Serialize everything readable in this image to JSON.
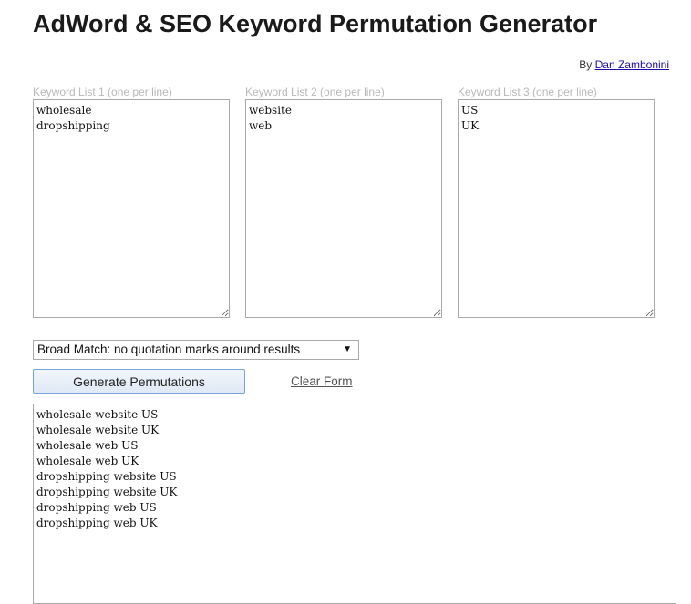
{
  "header": {
    "title": "AdWord & SEO Keyword Permutation Generator",
    "by_prefix": "By",
    "author": "Dan Zambonini"
  },
  "lists": [
    {
      "label": "Keyword List 1 (one per line)",
      "value": "wholesale\ndropshipping"
    },
    {
      "label": "Keyword List 2 (one per line)",
      "value": "website\nweb"
    },
    {
      "label": "Keyword List 3 (one per line)",
      "value": "US\nUK"
    }
  ],
  "match_select": {
    "selected": "Broad Match: no quotation marks around results"
  },
  "actions": {
    "generate_label": "Generate Permutations",
    "clear_label": "Clear Form"
  },
  "results": {
    "value": "wholesale website US\nwholesale website UK\nwholesale web US\nwholesale web UK\ndropshipping website US\ndropshipping website UK\ndropshipping web US\ndropshipping web UK"
  }
}
